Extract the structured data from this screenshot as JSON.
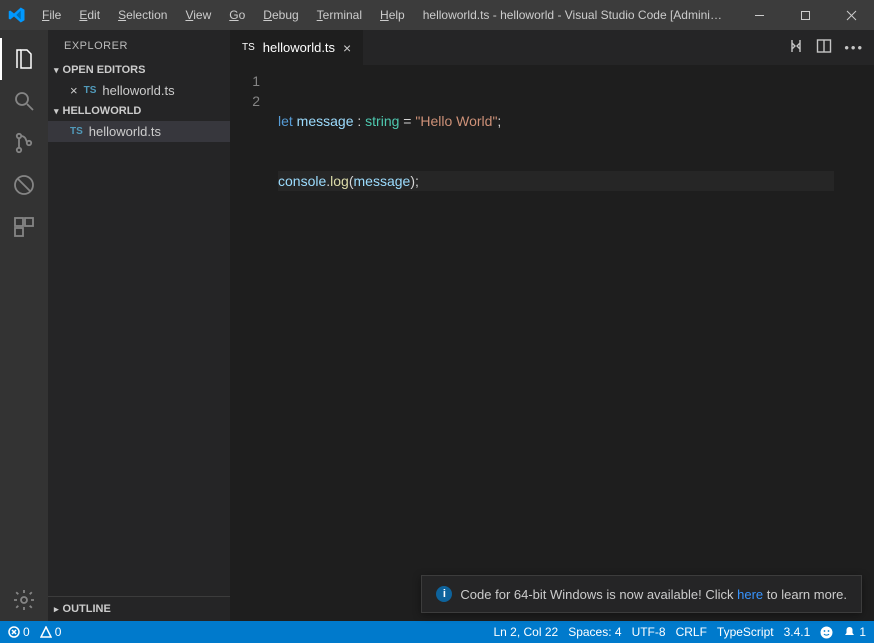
{
  "titlebar": {
    "menus": [
      "File",
      "Edit",
      "Selection",
      "View",
      "Go",
      "Debug",
      "Terminal",
      "Help"
    ],
    "title": "helloworld.ts - helloworld - Visual Studio Code [Administ..."
  },
  "sidebar": {
    "header": "EXPLORER",
    "open_editors_label": "OPEN EDITORS",
    "open_editor_item": "helloworld.ts",
    "folder_label": "HELLOWORLD",
    "folder_item": "helloworld.ts",
    "outline_label": "OUTLINE"
  },
  "tab": {
    "badge": "TS",
    "name": "helloworld.ts"
  },
  "code": {
    "lines": [
      "1",
      "2"
    ],
    "l1_kw": "let",
    "l1_var": " message ",
    "l1_colon": ": ",
    "l1_type": "string",
    "l1_eq": " = ",
    "l1_str": "\"Hello World\"",
    "l1_semi": ";",
    "l2_obj": "console",
    "l2_dot": ".",
    "l2_fn": "log",
    "l2_open": "(",
    "l2_arg": "message",
    "l2_close": ")",
    "l2_semi": ";"
  },
  "notification": {
    "pre": "Code for 64-bit Windows is now available! Click ",
    "link": "here",
    "post": " to learn more."
  },
  "statusbar": {
    "errors": "0",
    "warnings": "0",
    "ln_col": "Ln 2, Col 22",
    "spaces": "Spaces: 4",
    "encoding": "UTF-8",
    "eol": "CRLF",
    "language": "TypeScript",
    "version": "3.4.1",
    "bell": "1"
  }
}
